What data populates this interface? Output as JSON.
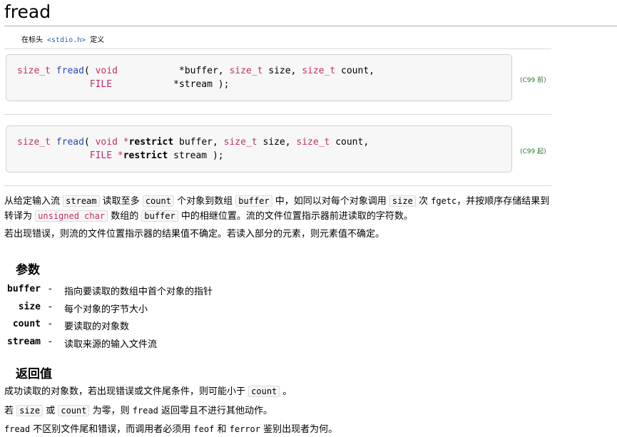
{
  "title": "fread",
  "header": {
    "prefix": "在标头",
    "file": "<stdio.h>",
    "suffix": "定义"
  },
  "signatures": [
    {
      "line1": {
        "t1": "size_t",
        "t2": "fread",
        "t3": "(",
        "t4": "void",
        "t5": "*buffer,",
        "t6": "size_t",
        "t7": "size,",
        "t8": "size_t",
        "t9": "count,"
      },
      "line2": {
        "t1": "FILE",
        "t2": "*stream );"
      },
      "version": "(C99 前)"
    },
    {
      "line1": {
        "t1": "size_t",
        "t2": "fread",
        "t3": "(",
        "t4": "void",
        "t5": "*",
        "t6": "restrict",
        "t7": "buffer,",
        "t8": "size_t",
        "t9": "size,",
        "t10": "size_t",
        "t11": "count,"
      },
      "line2": {
        "t1": "FILE",
        "t2": "*",
        "t3": "restrict",
        "t4": "stream );"
      },
      "version": "(C99 起)"
    }
  ],
  "description": {
    "p1_a": "从给定输入流",
    "p1_b": "stream",
    "p1_c": "读取至多",
    "p1_d": "count",
    "p1_e": "个对象到数组",
    "p1_f": "buffer",
    "p1_g": "中，如同以对每个对象调用",
    "p1_h": "size",
    "p1_i": "次",
    "p1_j": "fgetc",
    "p1_k": "，并按顺序存储结果到",
    "p2_a": "转译为",
    "p2_b": "unsigned char",
    "p2_c": "数组的",
    "p2_d": "buffer",
    "p2_e": "中的相继位置。流的文件位置指示器前进读取的字符数。",
    "p3": "若出现错误，则流的文件位置指示器的结果值不确定。若读入部分的元素，则元素值不确定。"
  },
  "params": {
    "heading": "参数",
    "items": [
      {
        "name": "buffer",
        "dash": "-",
        "desc": "指向要读取的数组中首个对象的指针"
      },
      {
        "name": "size",
        "dash": "-",
        "desc": "每个对象的字节大小"
      },
      {
        "name": "count",
        "dash": "-",
        "desc": "要读取的对象数"
      },
      {
        "name": "stream",
        "dash": "-",
        "desc": "读取来源的输入文件流"
      }
    ]
  },
  "return_value": {
    "heading": "返回值",
    "l1_a": "成功读取的对象数，若出现错误或文件尾条件，则可能小于",
    "l1_b": "count",
    "l1_c": "。",
    "l2_a": "若",
    "l2_b": "size",
    "l2_c": "或",
    "l2_d": "count",
    "l2_e": "为零，则",
    "l2_f": "fread",
    "l2_g": "返回零且不进行其他动作。",
    "l3_a": "fread",
    "l3_b": "不区别文件尾和错误，而调用者必须用",
    "l3_c": "feof",
    "l3_d": "和",
    "l3_e": "ferror",
    "l3_f": "鉴别出现者为何。"
  }
}
